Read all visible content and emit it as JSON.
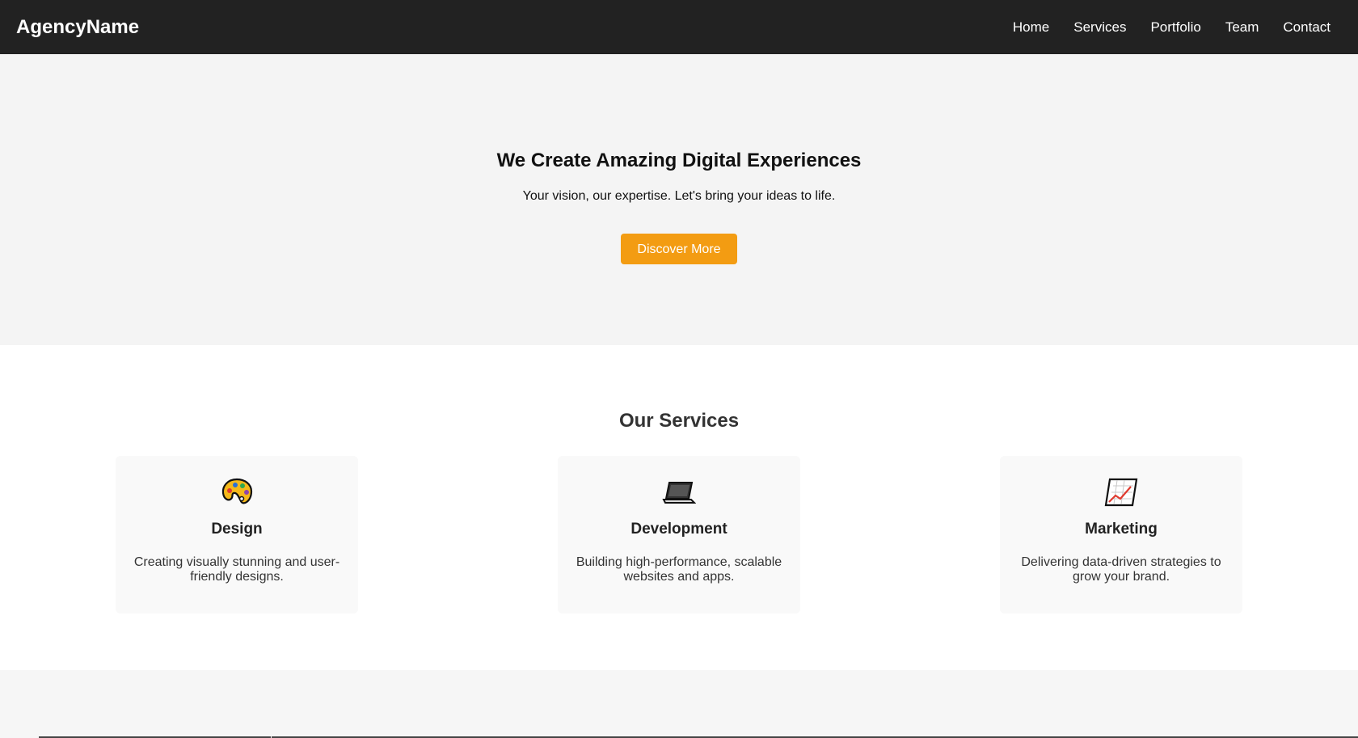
{
  "navbar": {
    "brand": "AgencyName",
    "links": [
      "Home",
      "Services",
      "Portfolio",
      "Team",
      "Contact"
    ]
  },
  "hero": {
    "title": "We Create Amazing Digital Experiences",
    "subtitle": "Your vision, our expertise. Let's bring your ideas to life.",
    "button_label": "Discover More"
  },
  "services": {
    "title": "Our Services",
    "items": [
      {
        "icon": "palette-icon",
        "title": "Design",
        "text": "Creating visually stunning and user-friendly designs."
      },
      {
        "icon": "laptop-icon",
        "title": "Development",
        "text": "Building high-performance, scalable websites and apps."
      },
      {
        "icon": "chart-icon",
        "title": "Marketing",
        "text": "Delivering data-driven strategies to grow your brand."
      }
    ]
  },
  "colors": {
    "navbar_bg": "#222222",
    "accent": "#f39c12",
    "hero_bg": "#f4f4f4",
    "card_bg": "#f9f9f9"
  }
}
